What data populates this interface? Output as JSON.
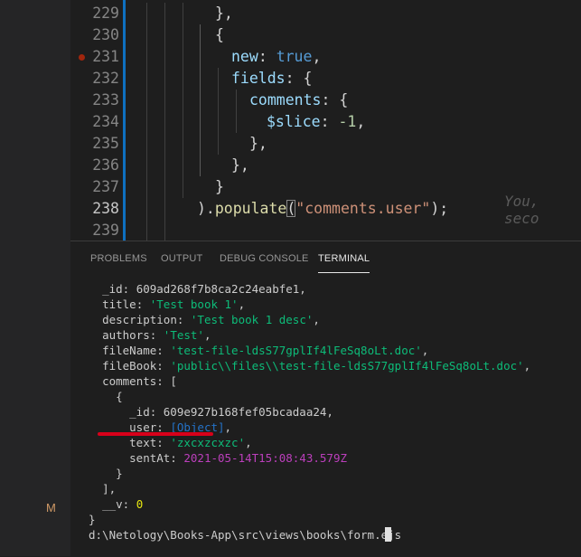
{
  "activity": {
    "scm_badge": "M"
  },
  "editor": {
    "lines": [
      {
        "num": "229",
        "tokens": [
          {
            "t": "},",
            "c": "punc"
          }
        ]
      },
      {
        "num": "230",
        "tokens": [
          {
            "t": "{",
            "c": "punc"
          }
        ]
      },
      {
        "num": "231",
        "tokens": [
          {
            "t": "new",
            "c": "prop"
          },
          {
            "t": ": ",
            "c": "punc"
          },
          {
            "t": "true",
            "c": "bool"
          },
          {
            "t": ",",
            "c": "punc"
          }
        ]
      },
      {
        "num": "232",
        "tokens": [
          {
            "t": "fields",
            "c": "prop"
          },
          {
            "t": ": {",
            "c": "punc"
          }
        ]
      },
      {
        "num": "233",
        "tokens": [
          {
            "t": "comments",
            "c": "prop"
          },
          {
            "t": ": {",
            "c": "punc"
          }
        ]
      },
      {
        "num": "234",
        "tokens": [
          {
            "t": "$slice",
            "c": "prop"
          },
          {
            "t": ": ",
            "c": "punc"
          },
          {
            "t": "-1",
            "c": "num"
          },
          {
            "t": ",",
            "c": "punc"
          }
        ]
      },
      {
        "num": "235",
        "tokens": [
          {
            "t": "},",
            "c": "punc"
          }
        ]
      },
      {
        "num": "236",
        "tokens": [
          {
            "t": "},",
            "c": "punc"
          }
        ]
      },
      {
        "num": "237",
        "tokens": [
          {
            "t": "}",
            "c": "punc"
          }
        ]
      },
      {
        "num": "238",
        "tokens": [
          {
            "t": ").",
            "c": "punc"
          },
          {
            "t": "populate",
            "c": "fn"
          },
          {
            "t": "(",
            "c": "punc"
          },
          {
            "t": "\"comments.user\"",
            "c": "str"
          },
          {
            "t": ");",
            "c": "punc"
          }
        ]
      },
      {
        "num": "239",
        "tokens": []
      }
    ],
    "ghost_text": "You, seco"
  },
  "panel": {
    "tabs": [
      "PROBLEMS",
      "OUTPUT",
      "DEBUG CONSOLE",
      "TERMINAL"
    ],
    "active_tab": "TERMINAL"
  },
  "terminal": {
    "lines": [
      {
        "indent": "  ",
        "tokens": [
          {
            "t": "_id: 609ad268f7b8ca2c24eabfe1,",
            "c": "plain"
          }
        ]
      },
      {
        "indent": "  ",
        "tokens": [
          {
            "t": "title: ",
            "c": "plain"
          },
          {
            "t": "'Test book 1'",
            "c": "str"
          },
          {
            "t": ",",
            "c": "plain"
          }
        ]
      },
      {
        "indent": "  ",
        "tokens": [
          {
            "t": "description: ",
            "c": "plain"
          },
          {
            "t": "'Test book 1 desc'",
            "c": "str"
          },
          {
            "t": ",",
            "c": "plain"
          }
        ]
      },
      {
        "indent": "  ",
        "tokens": [
          {
            "t": "authors: ",
            "c": "plain"
          },
          {
            "t": "'Test'",
            "c": "str"
          },
          {
            "t": ",",
            "c": "plain"
          }
        ]
      },
      {
        "indent": "  ",
        "tokens": [
          {
            "t": "fileName: ",
            "c": "plain"
          },
          {
            "t": "'test-file-ldsS77gplIf4lFeSq8oLt.doc'",
            "c": "str"
          },
          {
            "t": ",",
            "c": "plain"
          }
        ]
      },
      {
        "indent": "  ",
        "tokens": [
          {
            "t": "fileBook: ",
            "c": "plain"
          },
          {
            "t": "'public\\\\files\\\\test-file-ldsS77gplIf4lFeSq8oLt.doc'",
            "c": "str"
          },
          {
            "t": ",",
            "c": "plain"
          }
        ]
      },
      {
        "indent": "  ",
        "tokens": [
          {
            "t": "comments: [",
            "c": "plain"
          }
        ]
      },
      {
        "indent": "    ",
        "tokens": [
          {
            "t": "{",
            "c": "plain"
          }
        ]
      },
      {
        "indent": "      ",
        "tokens": [
          {
            "t": "_id: 609e927b168fef05bcadaa24,",
            "c": "plain"
          }
        ]
      },
      {
        "indent": "      ",
        "tokens": [
          {
            "t": "user: ",
            "c": "plain"
          },
          {
            "t": "[Object]",
            "c": "obj"
          },
          {
            "t": ",",
            "c": "plain"
          }
        ]
      },
      {
        "indent": "      ",
        "tokens": [
          {
            "t": "text: ",
            "c": "plain"
          },
          {
            "t": "'zxcxzcxzc'",
            "c": "str"
          },
          {
            "t": ",",
            "c": "plain"
          }
        ]
      },
      {
        "indent": "      ",
        "tokens": [
          {
            "t": "sentAt: ",
            "c": "plain"
          },
          {
            "t": "2021-05-14T15:08:43.579Z",
            "c": "date"
          }
        ]
      },
      {
        "indent": "    ",
        "tokens": [
          {
            "t": "}",
            "c": "plain"
          }
        ]
      },
      {
        "indent": "  ",
        "tokens": [
          {
            "t": "],",
            "c": "plain"
          }
        ]
      },
      {
        "indent": "  ",
        "tokens": [
          {
            "t": "__v: ",
            "c": "plain"
          },
          {
            "t": "0",
            "c": "num"
          }
        ]
      },
      {
        "indent": "",
        "tokens": [
          {
            "t": "}",
            "c": "plain"
          }
        ]
      },
      {
        "indent": "",
        "tokens": [
          {
            "t": "d:\\Netology\\Books-App\\src\\views\\books\\form.ejs",
            "c": "plain"
          }
        ]
      }
    ]
  },
  "colors": {
    "editor_bg": "#1e1e1e",
    "accent": "#0e70c0",
    "breakpoint": "#a1260d",
    "annotation_underline": "#d8001a"
  }
}
